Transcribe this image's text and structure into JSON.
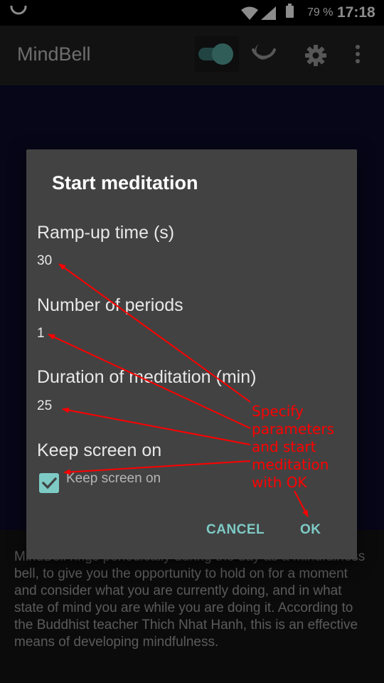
{
  "status_bar": {
    "battery": "79 %",
    "time": "17:18",
    "icons": [
      "loading-icon",
      "wifi-icon",
      "signal-icon",
      "battery-icon"
    ]
  },
  "app_bar": {
    "title": "MindBell",
    "icons": [
      "active-toggle",
      "bell-icon",
      "settings-icon",
      "overflow-menu-icon"
    ],
    "toggle_on": true
  },
  "background": {
    "text": "MindBell rings periodically during the day as a mindfulness bell, to give you the opportunity to hold on for a moment and consider what you are currently doing, and in what state of mind you are while you are doing it. According to the Buddhist teacher Thich Nhat Hanh, this is an effective means of developing mindfulness."
  },
  "dialog": {
    "title": "Start meditation",
    "fields": [
      {
        "label": "Ramp-up time (s)",
        "value": "30"
      },
      {
        "label": "Number of periods",
        "value": "1"
      },
      {
        "label": "Duration of meditation (min)",
        "value": "25"
      }
    ],
    "keep_screen": {
      "label": "Keep screen on",
      "checkbox_label": "Keep screen on",
      "checked": true
    },
    "cancel": "CANCEL",
    "ok": "OK"
  },
  "annotation": {
    "lines": [
      "Specify",
      "parameters",
      "and start",
      "meditation",
      "with OK"
    ],
    "color": "#ff0000"
  },
  "colors": {
    "accent": "#7ecbc6",
    "dialog_bg": "#424242",
    "app_bar_bg": "#212121"
  }
}
